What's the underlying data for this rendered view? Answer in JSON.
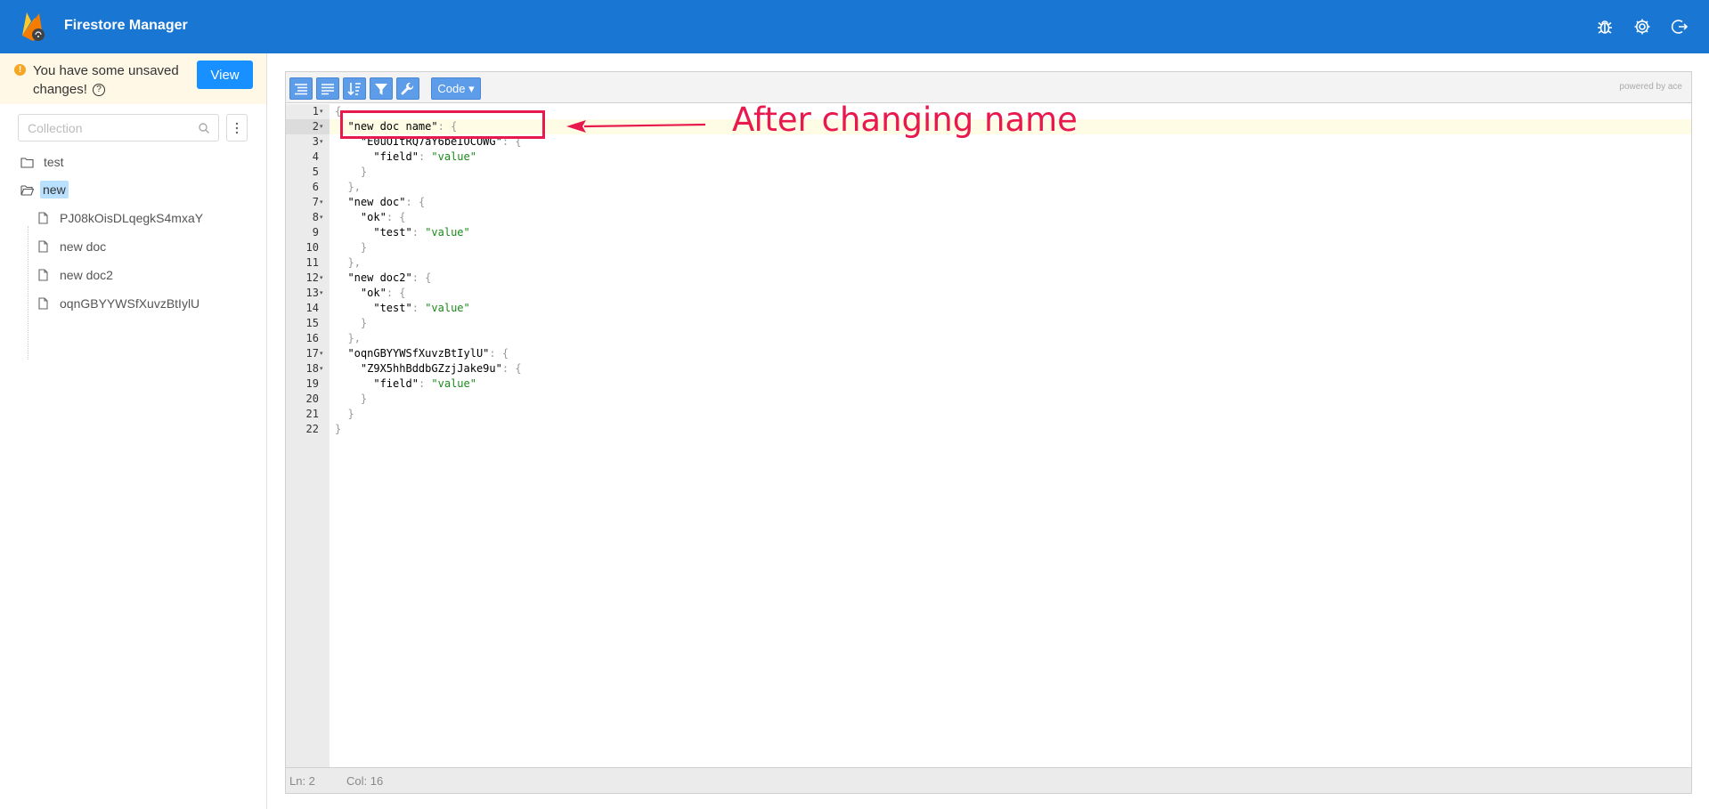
{
  "header": {
    "app_title": "Firestore Manager",
    "icons": [
      "bug-icon",
      "gear-icon",
      "logout-icon"
    ]
  },
  "sidebar": {
    "unsaved_message": "You have some unsaved changes!",
    "view_label": "View",
    "search_placeholder": "Collection",
    "tree": [
      {
        "label": "test",
        "type": "folder"
      },
      {
        "label": "new",
        "type": "folder-open",
        "selected": true,
        "children": [
          "PJ08kOisDLqegkS4mxaY",
          "new doc",
          "new doc2",
          "oqnGBYYWSfXuvzBtIylU"
        ]
      }
    ]
  },
  "editor": {
    "mode_label": "Code ▾",
    "powered_by": "powered by ace",
    "toolbar_icons": [
      "format-icon",
      "compact-icon",
      "sort-icon",
      "filter-icon",
      "repair-icon"
    ],
    "lines": [
      "{",
      "  \"new doc name\": {",
      "    \"E0uOItRQ7aY6beIOCOWG\": {",
      "      \"field\": \"value\"",
      "    }",
      "  },",
      "  \"new doc\": {",
      "    \"ok\": {",
      "      \"test\": \"value\"",
      "    }",
      "  },",
      "  \"new doc2\": {",
      "    \"ok\": {",
      "      \"test\": \"value\"",
      "    }",
      "  },",
      "  \"oqnGBYYWSfXuvzBtIylU\": {",
      "    \"Z9X5hhBddbGZzjJake9u\": {",
      "      \"field\": \"value\"",
      "    }",
      "  }",
      "}"
    ],
    "fold_lines": [
      1,
      2,
      3,
      7,
      8,
      12,
      13,
      17,
      18
    ],
    "status": {
      "ln": "Ln: 2",
      "col": "Col: 16"
    }
  },
  "annotation": {
    "text": "After changing name",
    "color": "#e8194e"
  },
  "colors": {
    "header_bg": "#1976d2",
    "accent": "#1890ff",
    "unsaved_bg": "#fff8e6",
    "string": "#1a8a1a"
  }
}
